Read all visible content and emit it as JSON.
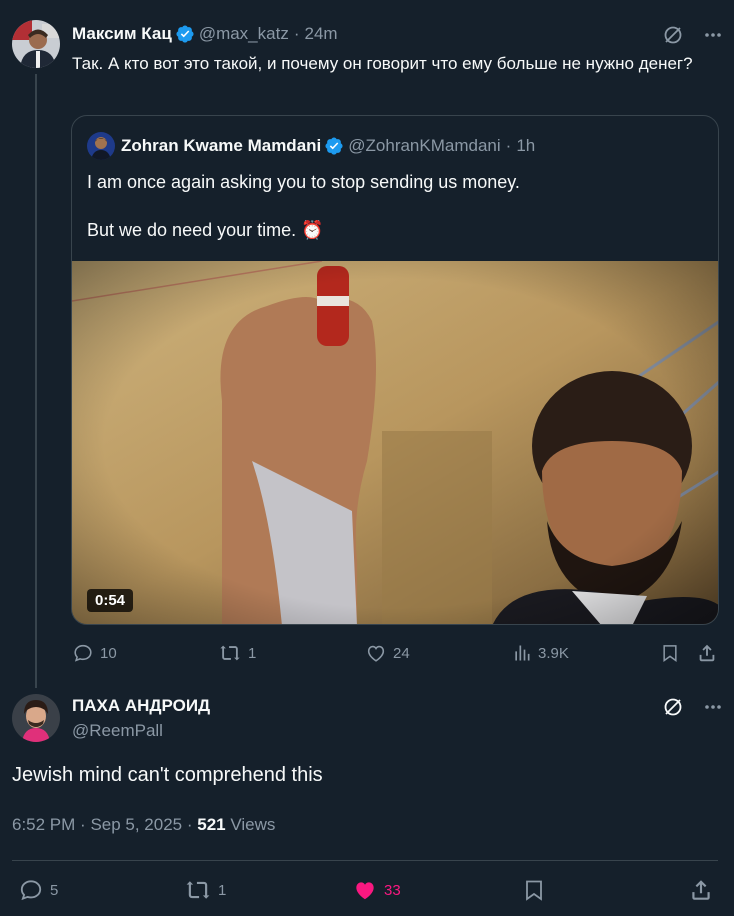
{
  "colors": {
    "bg": "#15202b",
    "border": "#38444d",
    "muted": "#8b98a5",
    "verified": "#1d9bf0",
    "like_active": "#f91880"
  },
  "tweet1": {
    "author_name": "Максим Кац",
    "handle": "@max_katz",
    "time": "24m",
    "text": "Так. А кто вот это такой, и почему он говорит что ему больше не нужно денег?",
    "quote": {
      "author_name": "Zohran Kwame Mamdani",
      "handle": "@ZohranKMamdani",
      "time": "1h",
      "line1": "I am once again asking you to stop sending us money.",
      "line2": "But we do need your time. ⏰",
      "video_duration": "0:54"
    },
    "stats": {
      "replies": "10",
      "reposts": "1",
      "likes": "24",
      "views": "3.9K"
    }
  },
  "tweet2": {
    "author_name": "ПАХА АНДРОИД",
    "handle": "@ReemPall",
    "text": "Jewish mind can't comprehend this",
    "time": "6:52 PM",
    "date": "Sep 5, 2025",
    "views_count": "521",
    "views_label": "Views",
    "stats": {
      "replies": "5",
      "reposts": "1",
      "likes": "33"
    }
  },
  "icons": [
    "grok-icon",
    "more-icon",
    "reply-icon",
    "repost-icon",
    "like-icon",
    "views-icon",
    "bookmark-icon",
    "share-icon",
    "verified-icon",
    "alarm-clock-emoji"
  ]
}
